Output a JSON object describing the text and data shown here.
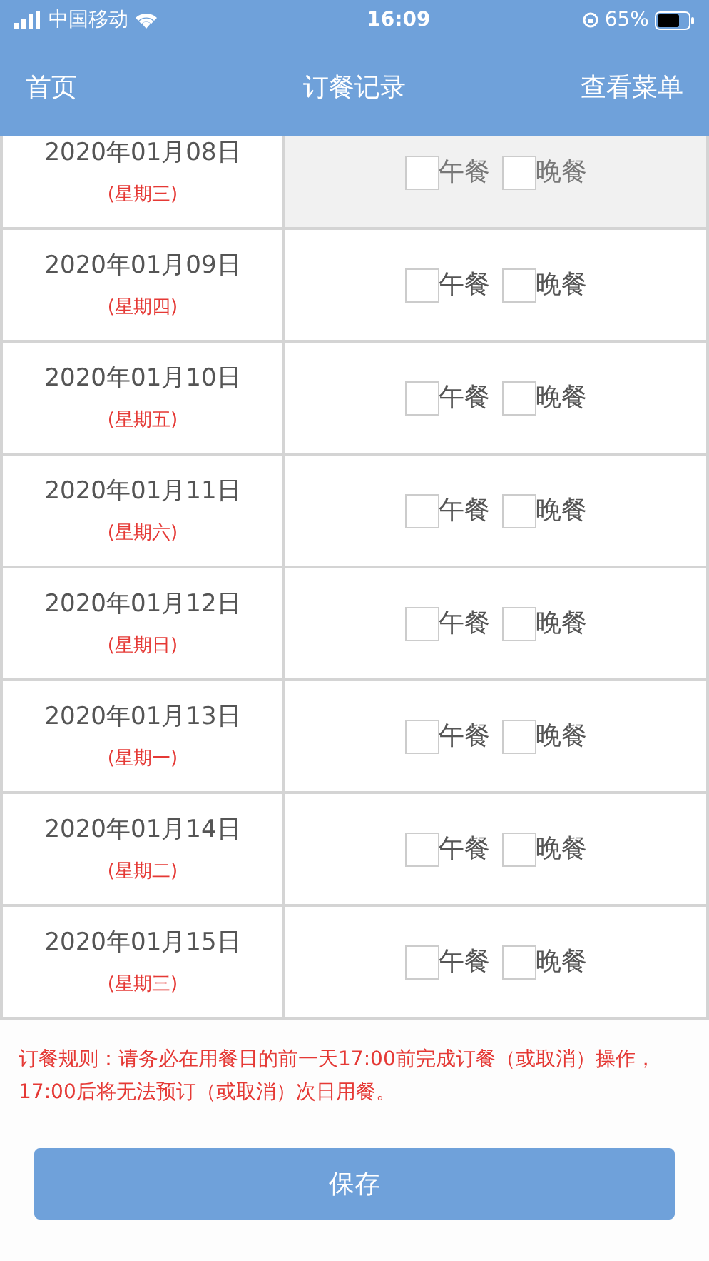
{
  "status_bar": {
    "carrier": "中国移动",
    "time": "16:09",
    "battery": "65%"
  },
  "nav": {
    "left": "首页",
    "title": "订餐记录",
    "right": "查看菜单"
  },
  "days": [
    {
      "date": "2020年01月08日",
      "weekday": "(星期三)",
      "disabled": true,
      "meals": [
        {
          "label": "午餐",
          "checked": false
        },
        {
          "label": "晚餐",
          "checked": false
        }
      ]
    },
    {
      "date": "2020年01月09日",
      "weekday": "(星期四)",
      "disabled": false,
      "meals": [
        {
          "label": "午餐",
          "checked": false
        },
        {
          "label": "晚餐",
          "checked": false
        }
      ]
    },
    {
      "date": "2020年01月10日",
      "weekday": "(星期五)",
      "disabled": false,
      "meals": [
        {
          "label": "午餐",
          "checked": false
        },
        {
          "label": "晚餐",
          "checked": false
        }
      ]
    },
    {
      "date": "2020年01月11日",
      "weekday": "(星期六)",
      "disabled": false,
      "meals": [
        {
          "label": "午餐",
          "checked": false
        },
        {
          "label": "晚餐",
          "checked": false
        }
      ]
    },
    {
      "date": "2020年01月12日",
      "weekday": "(星期日)",
      "disabled": false,
      "meals": [
        {
          "label": "午餐",
          "checked": false
        },
        {
          "label": "晚餐",
          "checked": false
        }
      ]
    },
    {
      "date": "2020年01月13日",
      "weekday": "(星期一)",
      "disabled": false,
      "meals": [
        {
          "label": "午餐",
          "checked": false
        },
        {
          "label": "晚餐",
          "checked": false
        }
      ]
    },
    {
      "date": "2020年01月14日",
      "weekday": "(星期二)",
      "disabled": false,
      "meals": [
        {
          "label": "午餐",
          "checked": false
        },
        {
          "label": "晚餐",
          "checked": false
        }
      ]
    },
    {
      "date": "2020年01月15日",
      "weekday": "(星期三)",
      "disabled": false,
      "meals": [
        {
          "label": "午餐",
          "checked": false
        },
        {
          "label": "晚餐",
          "checked": false
        }
      ]
    }
  ],
  "rule": "订餐规则：请务必在用餐日的前一天17:00前完成订餐（或取消）操作，17:00后将无法预订（或取消）次日用餐。",
  "save_button": "保存"
}
